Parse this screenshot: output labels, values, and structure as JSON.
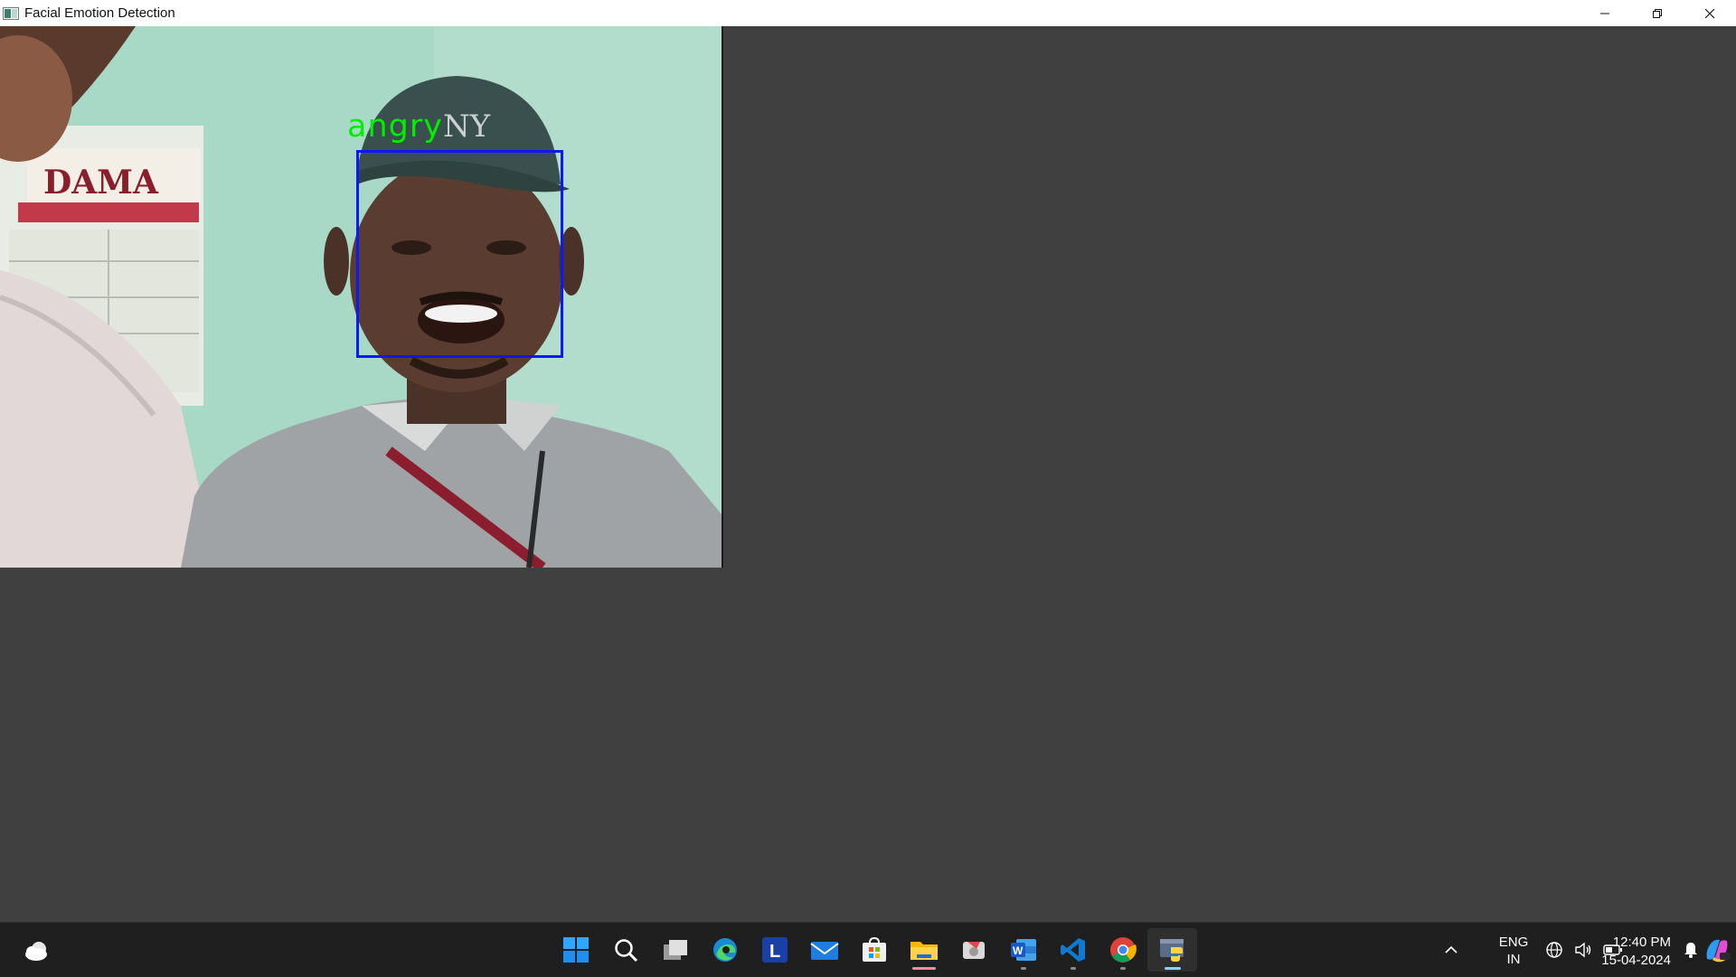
{
  "window": {
    "title": "Facial Emotion Detection",
    "icon": "opencv-window-icon",
    "controls": [
      "minimize-icon",
      "restore-icon",
      "close-icon"
    ]
  },
  "video": {
    "detected_emotion": "angry",
    "label_color": "#00ee00",
    "face_box_color": "#0a18ff",
    "background_sign_text": "DAMA"
  },
  "taskbar": {
    "weather_icon": "weather-cloud-icon",
    "apps": [
      {
        "name": "start",
        "icon": "windows-start-icon"
      },
      {
        "name": "search",
        "icon": "search-icon"
      },
      {
        "name": "task-view",
        "icon": "task-view-icon"
      },
      {
        "name": "edge",
        "icon": "edge-icon"
      },
      {
        "name": "l-app",
        "icon": "l-app-icon",
        "glyph": "L"
      },
      {
        "name": "mail",
        "icon": "mail-icon"
      },
      {
        "name": "store",
        "icon": "store-icon"
      },
      {
        "name": "file-explorer",
        "icon": "folder-icon"
      },
      {
        "name": "snipping",
        "icon": "snipping-icon"
      },
      {
        "name": "word",
        "icon": "word-icon",
        "glyph": "W"
      },
      {
        "name": "vscode",
        "icon": "vscode-icon"
      },
      {
        "name": "chrome",
        "icon": "chrome-icon"
      },
      {
        "name": "python",
        "icon": "python-icon"
      }
    ],
    "language_line1": "ENG",
    "language_line2": "IN",
    "time": "12:40 PM",
    "date": "15-04-2024"
  }
}
